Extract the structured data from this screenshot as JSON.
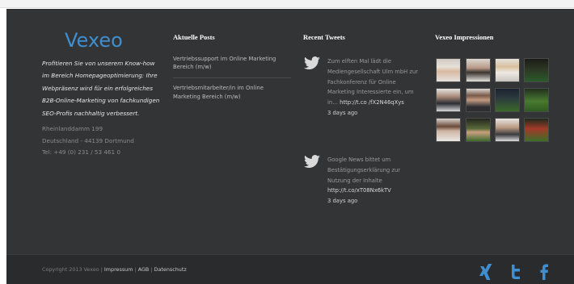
{
  "brand": {
    "logo_text": "Vexeo",
    "tagline": "Profitieren Sie von unserem Know-how im Bereich Homepageoptimierung: Ihre Webpräsenz wird für ein erfolgreiches B2B-Online-Marketing von fachkundigen SEO-Profis nachhaltig verbessert.",
    "address": {
      "street": "Rheinlanddamm 199",
      "city": "Deutschland - 44139 Dortmund",
      "phone": "Tel: +49 (0) 231 / 53 461 0"
    },
    "accent_color": "#3f8fd0"
  },
  "posts": {
    "heading": "Aktuelle Posts",
    "items": [
      {
        "title": "Vertriebssupport im Online Marketing Bereich (m/w)"
      },
      {
        "title": "Vertriebsmitarbeiter/in im Online Marketing Bereich (m/w)"
      }
    ]
  },
  "tweets": {
    "heading": "Recent Tweets",
    "items": [
      {
        "text": "Zum elften Mal lädt die Mediengesellschaft Ulm mbH zur Fachkonferenz für Online Marketing Interessierte ein, um in…",
        "link": "http://t.co /fX2N46qXys",
        "time": "3 days ago",
        "icon": "twitter-bird-icon"
      },
      {
        "text": "Google News bittet um Bestätigungserklärung zur Nutzung der Inhalte",
        "link": "http://t.co/xT08Nx6kTV",
        "time": "3 days ago",
        "icon": "twitter-bird-icon"
      }
    ]
  },
  "impressions": {
    "heading": "Vexeo Impressionen",
    "photos": [
      "portrait-woman",
      "portrait-woman",
      "portrait-woman",
      "soccer-field",
      "portrait-man",
      "portrait-man",
      "soccer-field",
      "soccer-field",
      "portrait-woman",
      "soccer-field",
      "portrait-man",
      "soccer-field"
    ]
  },
  "bottom_bar": {
    "copyright": "Copyright 2013 Vexeo |",
    "links": [
      "Impressum",
      "AGB",
      "Datenschutz"
    ],
    "separator": "|",
    "social_icons": [
      "xing-icon",
      "twitter-icon",
      "facebook-icon"
    ]
  }
}
